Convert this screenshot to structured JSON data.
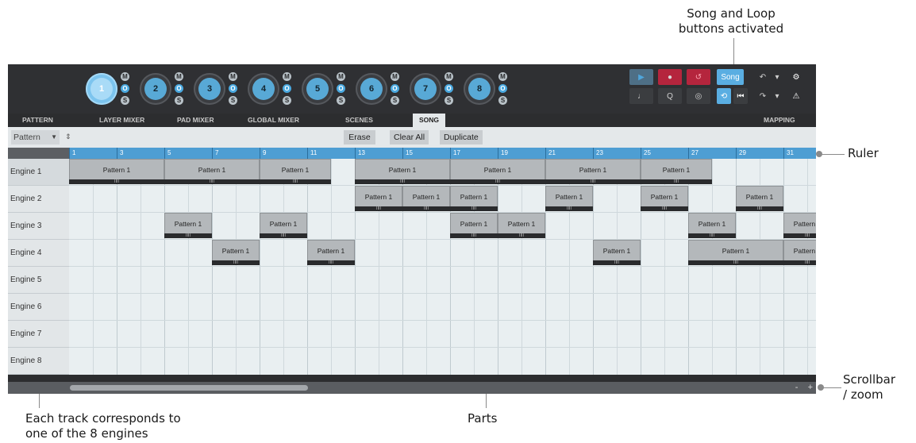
{
  "annotations": {
    "song_loop": {
      "line1": "Song and Loop",
      "line2": "buttons activated"
    },
    "ruler": "Ruler",
    "scrollbar": {
      "line1": "Scrollbar",
      "line2": "/ zoom"
    },
    "tracks": {
      "line1": "Each track corresponds to",
      "line2": "one of the 8 engines"
    },
    "parts": "Parts"
  },
  "engines": [
    {
      "num": "1",
      "active": true
    },
    {
      "num": "2"
    },
    {
      "num": "3"
    },
    {
      "num": "4"
    },
    {
      "num": "5"
    },
    {
      "num": "6"
    },
    {
      "num": "7"
    },
    {
      "num": "8"
    }
  ],
  "mos": {
    "m": "M",
    "o": "O",
    "s": "S"
  },
  "transport": {
    "play": "▶",
    "record": "●",
    "undo_loop": "↺",
    "song": "Song",
    "metronome": "♩",
    "quantize": "Q",
    "sync": "◎",
    "loop": "⟲",
    "rewind": "⏮",
    "undo": "↶",
    "redo": "↷",
    "dropdown": "▾",
    "settings": "⚙",
    "warning": "⚠"
  },
  "tabs": [
    "PATTERN",
    "LAYER MIXER",
    "PAD MIXER",
    "GLOBAL MIXER",
    "SCENES",
    "SONG",
    "MAPPING"
  ],
  "toolbar": {
    "select_value": "Pattern",
    "select_arrow": "▼",
    "stepper": "⇕",
    "erase": "Erase",
    "clear_all": "Clear All",
    "duplicate": "Duplicate"
  },
  "ruler_ticks": [
    "1",
    "3",
    "5",
    "7",
    "9",
    "11",
    "13",
    "15",
    "17",
    "19",
    "21",
    "23",
    "25",
    "27",
    "29",
    "31"
  ],
  "tracks": [
    "Engine 1",
    "Engine 2",
    "Engine 3",
    "Engine 4",
    "Engine 5",
    "Engine 6",
    "Engine 7",
    "Engine 8"
  ],
  "parts": [
    {
      "track": 1,
      "start": 1,
      "end": 5,
      "label": "Pattern 1"
    },
    {
      "track": 1,
      "start": 5,
      "end": 9,
      "label": "Pattern 1"
    },
    {
      "track": 1,
      "start": 9,
      "end": 12,
      "label": "Pattern 1"
    },
    {
      "track": 1,
      "start": 13,
      "end": 17,
      "label": "Pattern 1"
    },
    {
      "track": 1,
      "start": 17,
      "end": 21,
      "label": "Pattern 1"
    },
    {
      "track": 1,
      "start": 21,
      "end": 25,
      "label": "Pattern 1"
    },
    {
      "track": 1,
      "start": 25,
      "end": 28,
      "label": "Pattern 1"
    },
    {
      "track": 2,
      "start": 13,
      "end": 15,
      "label": "Pattern 1"
    },
    {
      "track": 2,
      "start": 15,
      "end": 17,
      "label": "Pattern 1"
    },
    {
      "track": 2,
      "start": 17,
      "end": 19,
      "label": "Pattern 1"
    },
    {
      "track": 2,
      "start": 21,
      "end": 23,
      "label": "Pattern 1"
    },
    {
      "track": 2,
      "start": 25,
      "end": 27,
      "label": "Pattern 1"
    },
    {
      "track": 2,
      "start": 29,
      "end": 31,
      "label": "Pattern 1"
    },
    {
      "track": 3,
      "start": 5,
      "end": 7,
      "label": "Pattern 1"
    },
    {
      "track": 3,
      "start": 9,
      "end": 11,
      "label": "Pattern 1"
    },
    {
      "track": 3,
      "start": 17,
      "end": 19,
      "label": "Pattern 1"
    },
    {
      "track": 3,
      "start": 19,
      "end": 21,
      "label": "Pattern 1"
    },
    {
      "track": 3,
      "start": 27,
      "end": 29,
      "label": "Pattern 1"
    },
    {
      "track": 3,
      "start": 31,
      "end": 33,
      "label": "Pattern 1"
    },
    {
      "track": 4,
      "start": 7,
      "end": 9,
      "label": "Pattern 1"
    },
    {
      "track": 4,
      "start": 11,
      "end": 13,
      "label": "Pattern 1"
    },
    {
      "track": 4,
      "start": 23,
      "end": 25,
      "label": "Pattern 1"
    },
    {
      "track": 4,
      "start": 27,
      "end": 31,
      "label": "Pattern 1"
    },
    {
      "track": 4,
      "start": 31,
      "end": 33,
      "label": "Pattern 1"
    }
  ],
  "part_foot_glyph": "IIII",
  "zoom": {
    "minus": "-",
    "plus": "+"
  },
  "colors": {
    "accent": "#4e9ed3",
    "record": "#b5253d",
    "song_active": "#5aaee2"
  }
}
